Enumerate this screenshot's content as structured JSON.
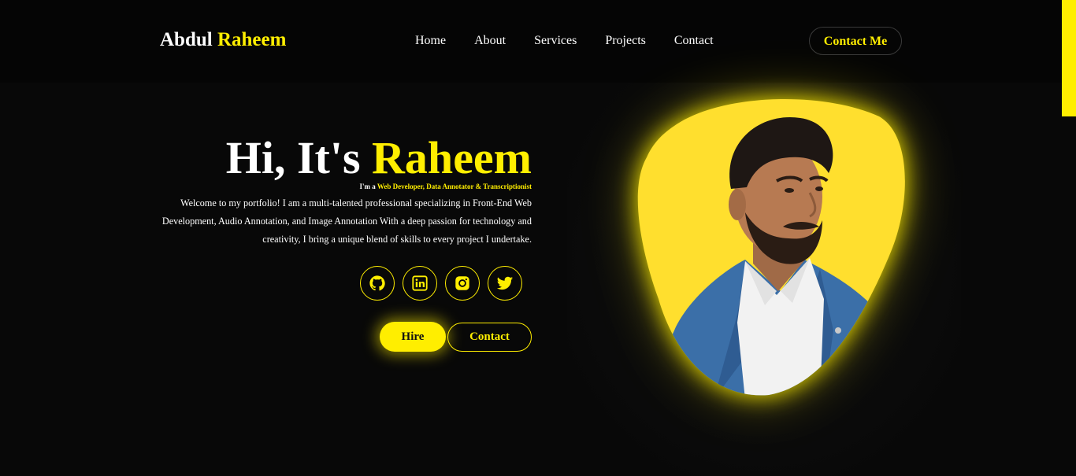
{
  "header": {
    "logo_first": "Abdul",
    "logo_second": "Raheem",
    "nav": [
      "Home",
      "About",
      "Services",
      "Projects",
      "Contact"
    ],
    "cta_label": "Contact Me"
  },
  "hero": {
    "title_prefix": "Hi, It's",
    "title_name": "Raheem",
    "role_prefix": "I'm a",
    "roles": "Web Developer, Data Annotator & Transcriptionist",
    "intro": "Welcome to my portfolio! I am a multi-talented professional specializing in Front-End Web Development, Audio Annotation, and Image Annotation With a deep passion for technology and creativity, I bring a unique blend of skills to every project I undertake.",
    "hire_label": "Hire",
    "contact_label": "Contact"
  },
  "socials": [
    {
      "icon": "github-icon"
    },
    {
      "icon": "linkedin-icon"
    },
    {
      "icon": "instagram-icon"
    },
    {
      "icon": "twitter-icon"
    }
  ],
  "colors": {
    "accent": "#ffee00",
    "background": "#080808",
    "text": "#ffffff"
  }
}
